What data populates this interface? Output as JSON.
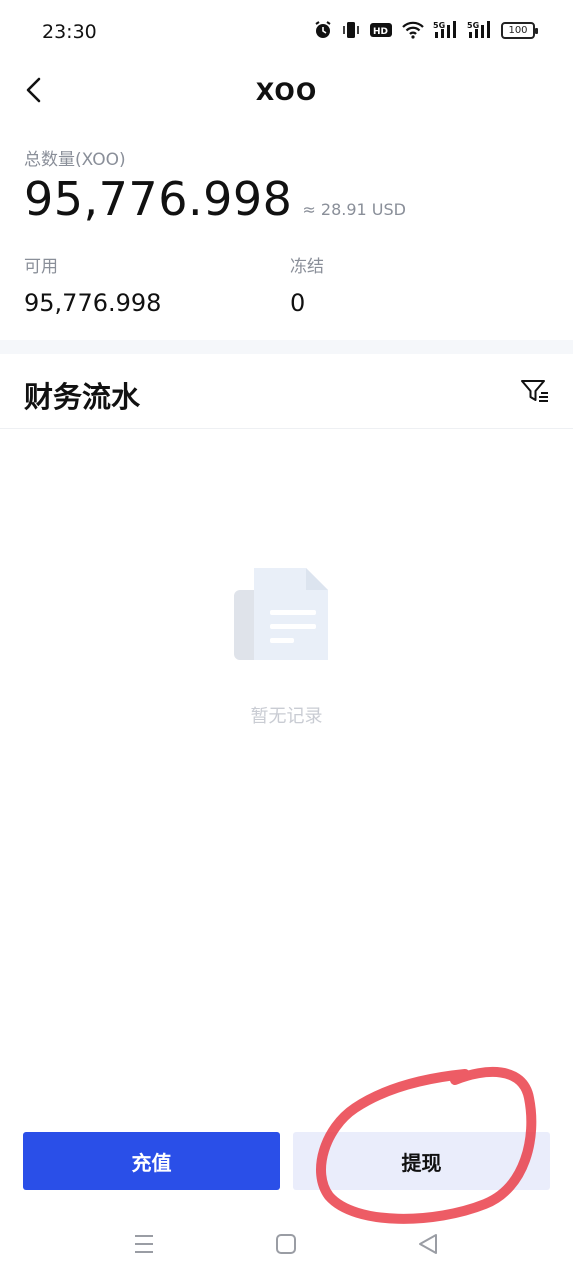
{
  "status_bar": {
    "time": "23:30",
    "battery": "100",
    "icons": [
      "alarm-icon",
      "vibrate-icon",
      "hd-icon",
      "wifi-icon",
      "signal-5g-icon",
      "signal-5g-icon",
      "battery-icon"
    ]
  },
  "header": {
    "title": "XOO",
    "back_icon": "chevron-left-icon"
  },
  "balance": {
    "total_label": "总数量(XOO)",
    "total_amount": "95,776.998",
    "usd_value": "≈ 28.91 USD",
    "available_label": "可用",
    "available_value": "95,776.998",
    "frozen_label": "冻结",
    "frozen_value": "0"
  },
  "ledger": {
    "title": "财务流水",
    "filter_icon": "filter-icon",
    "empty_text": "暂无记录"
  },
  "actions": {
    "deposit_label": "充值",
    "withdraw_label": "提现"
  },
  "colors": {
    "primary": "#2a4fe8",
    "secondary_button": "#eaedfb",
    "annotation": "#e8333f",
    "muted_text": "#8a8f99"
  }
}
